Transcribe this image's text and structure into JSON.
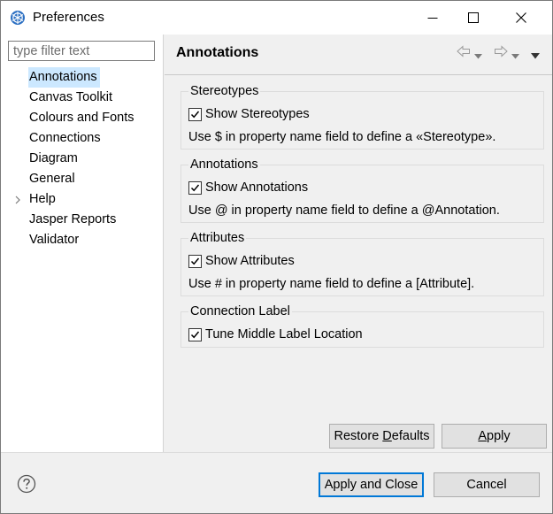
{
  "window": {
    "title": "Preferences"
  },
  "filter": {
    "placeholder": "type filter text",
    "value": ""
  },
  "tree": {
    "items": [
      {
        "label": "Annotations",
        "selected": true,
        "expandable": false
      },
      {
        "label": "Canvas Toolkit",
        "selected": false,
        "expandable": false
      },
      {
        "label": "Colours and Fonts",
        "selected": false,
        "expandable": false
      },
      {
        "label": "Connections",
        "selected": false,
        "expandable": false
      },
      {
        "label": "Diagram",
        "selected": false,
        "expandable": false
      },
      {
        "label": "General",
        "selected": false,
        "expandable": false
      },
      {
        "label": "Help",
        "selected": false,
        "expandable": true
      },
      {
        "label": "Jasper Reports",
        "selected": false,
        "expandable": false
      },
      {
        "label": "Validator",
        "selected": false,
        "expandable": false
      }
    ]
  },
  "page": {
    "title": "Annotations",
    "groups": [
      {
        "title": "Stereotypes",
        "checkbox_label": "Show Stereotypes",
        "checked": true,
        "hint": "Use $ in property name field to define a «Stereotype»."
      },
      {
        "title": "Annotations",
        "checkbox_label": "Show Annotations",
        "checked": true,
        "hint": "Use @ in property name field to define a @Annotation."
      },
      {
        "title": "Attributes",
        "checkbox_label": "Show Attributes",
        "checked": true,
        "hint": "Use # in property name field to define a [Attribute]."
      },
      {
        "title": "Connection Label",
        "checkbox_label": "Tune Middle Label Location",
        "checked": true
      }
    ],
    "restore_defaults_label": {
      "before": "Restore ",
      "mnemonic": "D",
      "after": "efaults"
    },
    "apply_label": {
      "before": "",
      "mnemonic": "A",
      "after": "pply"
    }
  },
  "footer": {
    "apply_close_label": "Apply and Close",
    "cancel_label": "Cancel"
  },
  "colors": {
    "selection": "#cce8ff",
    "default_button_border": "#0078d7",
    "app_icon": "#2b6fc2"
  }
}
